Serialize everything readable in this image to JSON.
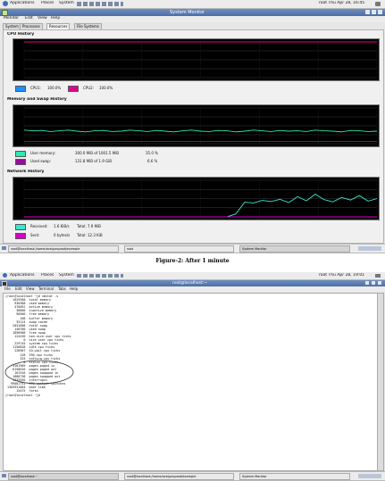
{
  "screen1": {
    "menubar": {
      "items": [
        "Applications",
        "Places",
        "System"
      ],
      "clock": "root  Thu Apr 28, 16:45"
    },
    "window": {
      "title": "System Monitor",
      "menu": [
        "Monitor",
        "Edit",
        "View",
        "Help"
      ],
      "tabs": [
        "System",
        "Processes",
        "Resources",
        "File Systems"
      ],
      "active_tab": "Resources"
    },
    "cpu": {
      "heading": "CPU History",
      "legend": [
        {
          "label": "CPU1:",
          "value": "100.0%",
          "color": "#1e90ff"
        },
        {
          "label": "CPU2:",
          "value": "100.0%",
          "color": "#e4008f"
        }
      ]
    },
    "memory": {
      "heading": "Memory and Swap History",
      "legend": [
        {
          "label": "User memory:",
          "value": "300.0 MiB   of  1001.5 MiB",
          "pct": "35.0 %",
          "color": "#2ee8b5"
        },
        {
          "label": "Used swap:",
          "value": "131.8 MiB   of  1.9 GiB",
          "pct": "6.6 %",
          "color": "#9b0b9f"
        }
      ]
    },
    "network": {
      "heading": "Network History",
      "legend": [
        {
          "label": "Received:",
          "value": "1.6 KiB/s",
          "total": "Total:  7.9 MiB",
          "color": "#39e8d0"
        },
        {
          "label": "Sent:",
          "value": "0 bytes/s",
          "total": "Total:  12.3 KiB",
          "color": "#d600c8"
        }
      ]
    },
    "taskbar": [
      "root@localhost:/home/ace/pzvpaot/example",
      "root",
      "System Monitor"
    ]
  },
  "caption": "Figure-2: After 1 minute",
  "screen2": {
    "menubar": {
      "items": [
        "Applications",
        "Places",
        "System"
      ],
      "clock": "root  Thu Apr 28, 19:01"
    },
    "window": {
      "title": "root@localhost:~",
      "menu": [
        "File",
        "Edit",
        "View",
        "Terminal",
        "Tabs",
        "Help"
      ]
    },
    "terminal": {
      "lines": [
        "[root@localhost ~]# vmstat -s",
        "    1025948  total memory",
        "     930368  used memory",
        "     470052  active memory",
        "      38800  inactive memory",
        "      90580  free memory",
        "        108  buffer memory",
        "      35124  swap cache",
        "    2031608  total swap",
        "     140700  used swap",
        "    1890908  free swap",
        "     124430  non-nice user cpu ticks",
        "          0  nice user cpu ticks",
        "     229745  system cpu ticks",
        "    1156828  idle cpu ticks",
        "     228907  IO-wait cpu ticks",
        "        128  IRQ cpu ticks",
        "        333  softirq cpu ticks",
        "          0  stolen cpu ticks",
        "    3161909  pages paged in",
        "    6158016  pages paged out",
        "     161916  pages swapped in",
        "    1688738  pages swapped out",
        "    1333556  interrupts",
        "   99081731  CPU context switches",
        " 1303931004  boot time",
        "      15475  forks",
        "[root@localhost ~]# "
      ]
    },
    "taskbar": [
      "root@localhost:~",
      "root@localhost:/home/ace/pzvpaot/example",
      "System Monitor"
    ]
  },
  "chart_data": [
    {
      "type": "line",
      "title": "CPU History",
      "x": [
        0,
        1,
        2,
        3,
        4,
        5,
        6,
        7,
        8,
        9,
        10,
        11,
        12,
        13,
        14,
        15,
        16,
        17,
        18,
        19,
        20,
        21,
        22,
        23,
        24,
        25,
        26,
        27,
        28,
        29,
        30,
        31,
        32,
        33,
        34,
        35,
        36,
        37,
        38,
        39,
        40
      ],
      "series": [
        {
          "name": "CPU1",
          "values": [
            100,
            100,
            100,
            100,
            100,
            100,
            100,
            100,
            100,
            100,
            100,
            100,
            100,
            100,
            100,
            100,
            100,
            100,
            100,
            100,
            100,
            100,
            100,
            100,
            100,
            100,
            100,
            100,
            100,
            100,
            100,
            100,
            100,
            100,
            100,
            100,
            100,
            100,
            100,
            100,
            100
          ]
        },
        {
          "name": "CPU2",
          "values": [
            100,
            100,
            100,
            100,
            100,
            100,
            100,
            100,
            100,
            100,
            100,
            100,
            100,
            100,
            100,
            100,
            100,
            100,
            100,
            100,
            100,
            100,
            100,
            100,
            100,
            100,
            100,
            100,
            100,
            100,
            100,
            100,
            100,
            100,
            100,
            100,
            100,
            100,
            100,
            100,
            100
          ]
        }
      ],
      "ylim": [
        0,
        100
      ]
    },
    {
      "type": "line",
      "title": "Memory and Swap History",
      "x": [
        0,
        1,
        2,
        3,
        4,
        5,
        6,
        7,
        8,
        9,
        10,
        11,
        12,
        13,
        14,
        15,
        16,
        17,
        18,
        19,
        20,
        21,
        22,
        23,
        24,
        25,
        26,
        27,
        28,
        29,
        30,
        31,
        32,
        33,
        34,
        35,
        36,
        37,
        38,
        39,
        40
      ],
      "series": [
        {
          "name": "User memory",
          "values": [
            38,
            36,
            37,
            34,
            36,
            38,
            35,
            33,
            36,
            37,
            34,
            35,
            38,
            36,
            34,
            37,
            35,
            33,
            36,
            38,
            35,
            34,
            37,
            36,
            33,
            35,
            38,
            36,
            34,
            37,
            35,
            36,
            34,
            38,
            36,
            35,
            33,
            37,
            36,
            34,
            35
          ]
        },
        {
          "name": "Used swap",
          "values": [
            6.6,
            6.6,
            6.6,
            6.6,
            6.6,
            6.6,
            6.6,
            6.6,
            6.6,
            6.6,
            6.6,
            6.6,
            6.6,
            6.6,
            6.6,
            6.6,
            6.6,
            6.6,
            6.6,
            6.6,
            6.6,
            6.6,
            6.6,
            6.6,
            6.6,
            6.6,
            6.6,
            6.6,
            6.6,
            6.6,
            6.6,
            6.6,
            6.6,
            6.6,
            6.6,
            6.6,
            6.6,
            6.6,
            6.6,
            6.6,
            6.6
          ]
        }
      ],
      "ylim": [
        0,
        100
      ]
    },
    {
      "type": "line",
      "title": "Network History",
      "x": [
        0,
        1,
        2,
        3,
        4,
        5,
        6,
        7,
        8,
        9,
        10,
        11,
        12,
        13,
        14,
        15,
        16,
        17,
        18,
        19,
        20,
        21,
        22,
        23,
        24,
        25,
        26,
        27,
        28,
        29,
        30,
        31,
        32,
        33,
        34,
        35,
        36,
        37,
        38,
        39,
        40
      ],
      "series": [
        {
          "name": "Received",
          "values": [
            0,
            0,
            0,
            0,
            0,
            0,
            0,
            0,
            0,
            0,
            0,
            0,
            0,
            0,
            0,
            0,
            0,
            0,
            0,
            0,
            0,
            0,
            0,
            0,
            8,
            40,
            38,
            45,
            42,
            48,
            39,
            55,
            44,
            62,
            47,
            41,
            53,
            46,
            58,
            43,
            50
          ]
        },
        {
          "name": "Sent",
          "values": [
            0,
            0,
            0,
            0,
            0,
            0,
            0,
            0,
            0,
            0,
            0,
            0,
            0,
            0,
            0,
            0,
            0,
            0,
            0,
            0,
            0,
            0,
            0,
            0,
            0,
            0,
            0,
            0,
            0,
            0,
            0,
            0,
            0,
            0,
            0,
            0,
            0,
            0,
            0,
            0,
            0
          ]
        }
      ],
      "ylim": [
        0,
        100
      ]
    }
  ]
}
